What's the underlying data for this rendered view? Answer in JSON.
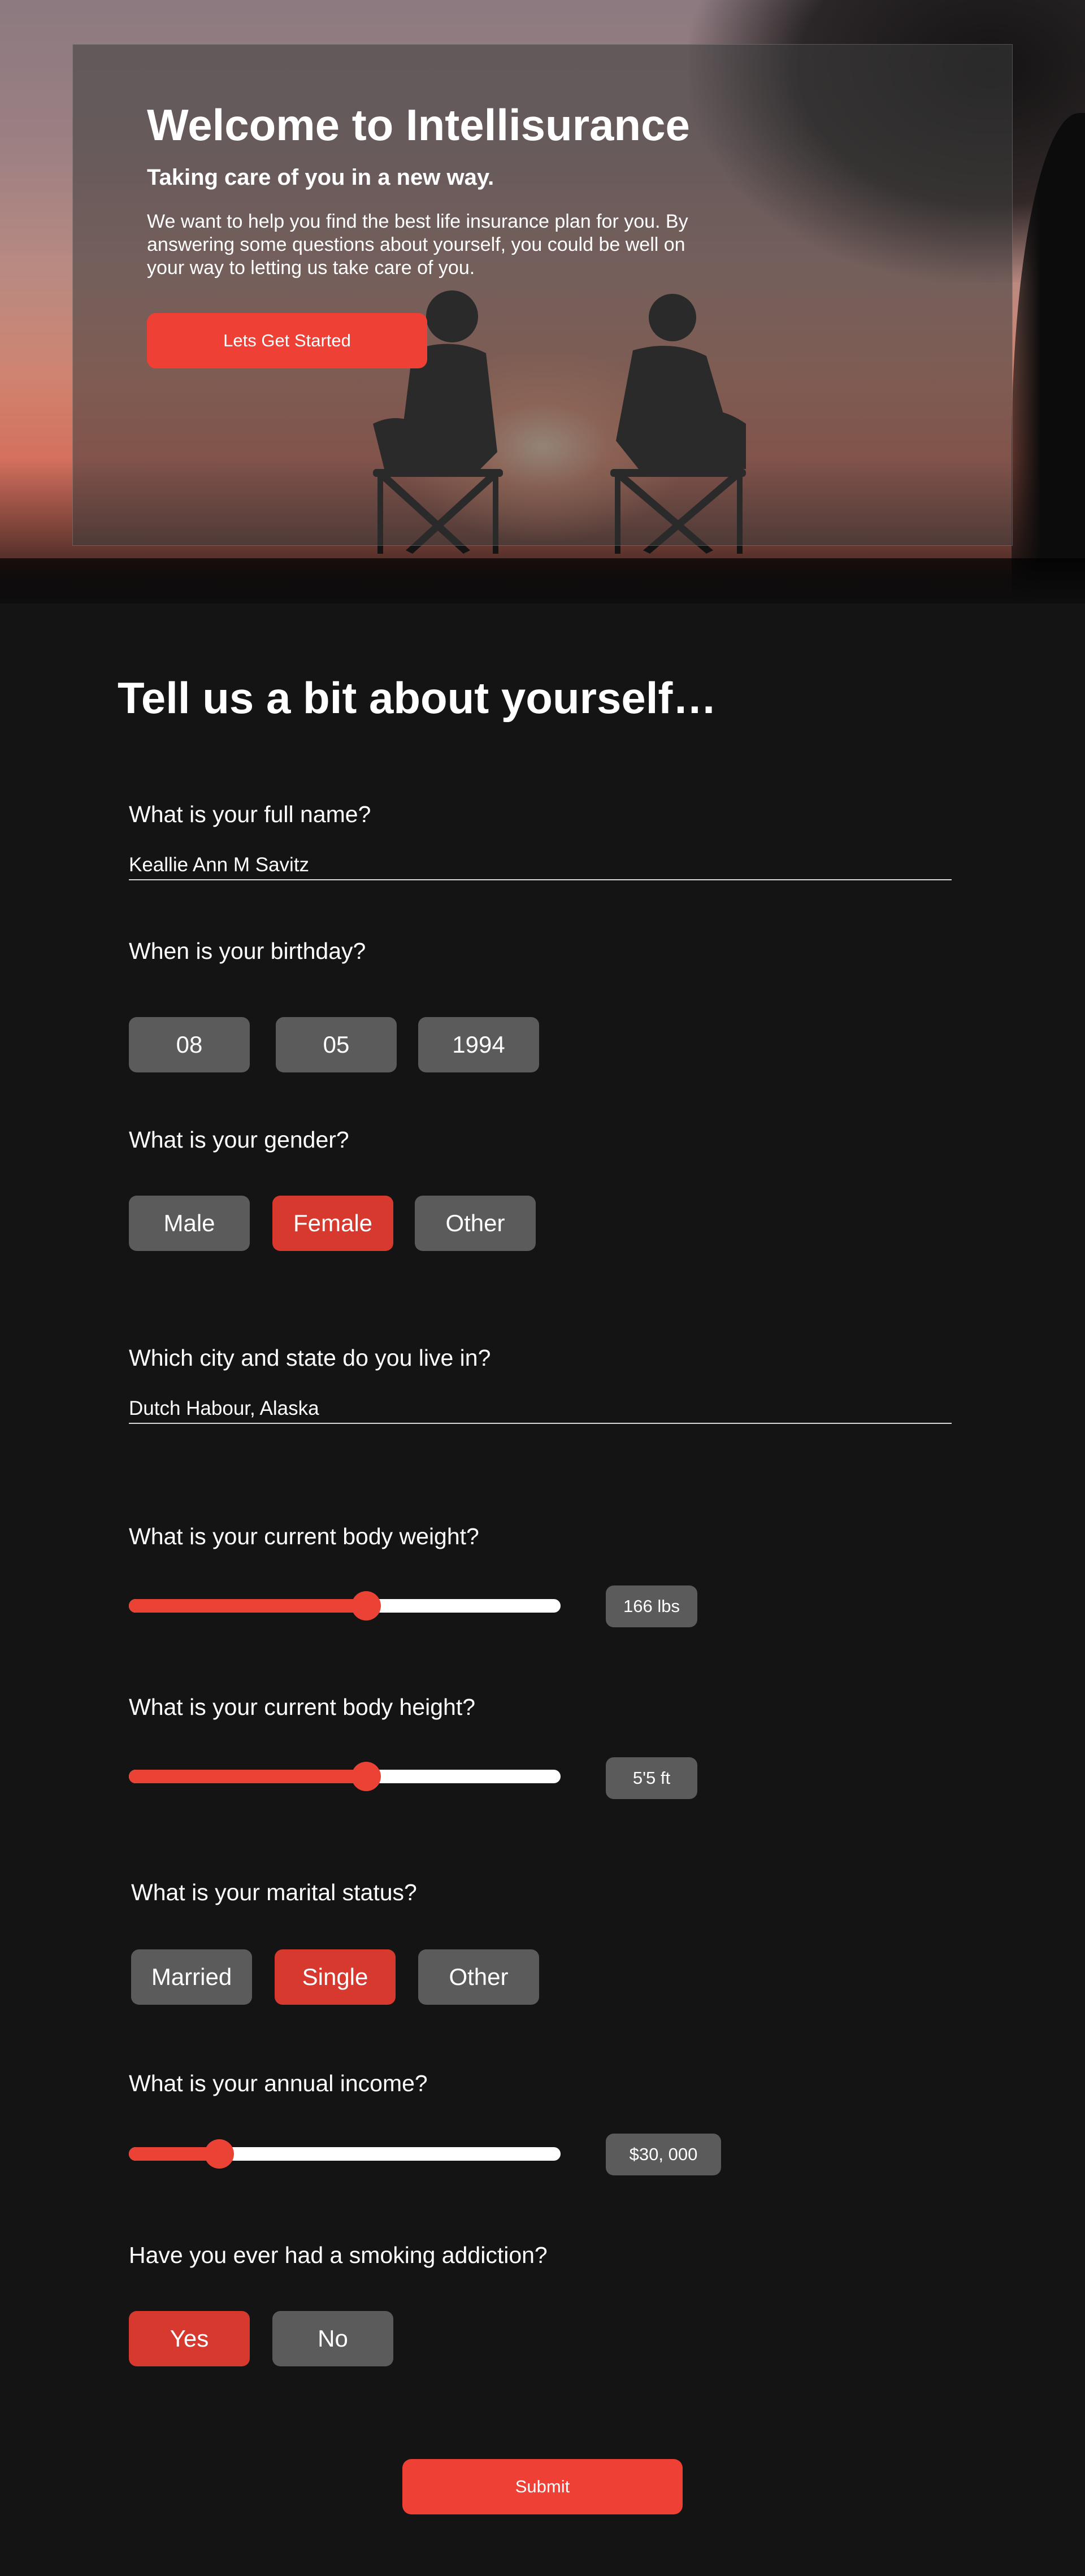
{
  "hero": {
    "title": "Welcome to Intellisurance",
    "subtitle": "Taking care of you in a new way.",
    "body": "We want to help you find the best life insurance plan for you. By answering some questions about yourself, you could be well on your way to letting us take care of you.",
    "cta_label": "Lets Get Started"
  },
  "form": {
    "title": "Tell us a bit about yourself…",
    "name": {
      "question": "What is your full name?",
      "value": "Keallie Ann M Savitz"
    },
    "birthday": {
      "question": "When is your birthday?",
      "month": "08",
      "day": "05",
      "year": "1994"
    },
    "gender": {
      "question": "What is your gender?",
      "options": [
        "Male",
        "Female",
        "Other"
      ],
      "selected": "Female"
    },
    "location": {
      "question": "Which city and state do you live in?",
      "value": "Dutch Habour, Alaska"
    },
    "weight": {
      "question": "What is your current body weight?",
      "display": "166 lbs",
      "level": 0.55
    },
    "height": {
      "question": "What is your current body height?",
      "display": "5'5 ft",
      "level": 0.55
    },
    "marital": {
      "question": "What is your marital status?",
      "options": [
        "Married",
        "Single",
        "Other"
      ],
      "selected": "Single"
    },
    "income": {
      "question": "What is your annual income?",
      "display": "$30, 000",
      "level": 0.21
    },
    "smoking": {
      "question": "Have you ever had a smoking addiction?",
      "options": [
        "Yes",
        "No"
      ],
      "selected": "Yes"
    },
    "submit_label": "Submit"
  },
  "colors": {
    "accent": "#ee4035",
    "selected": "#d7392f",
    "pill": "#5b5b5b",
    "background": "#141414"
  }
}
